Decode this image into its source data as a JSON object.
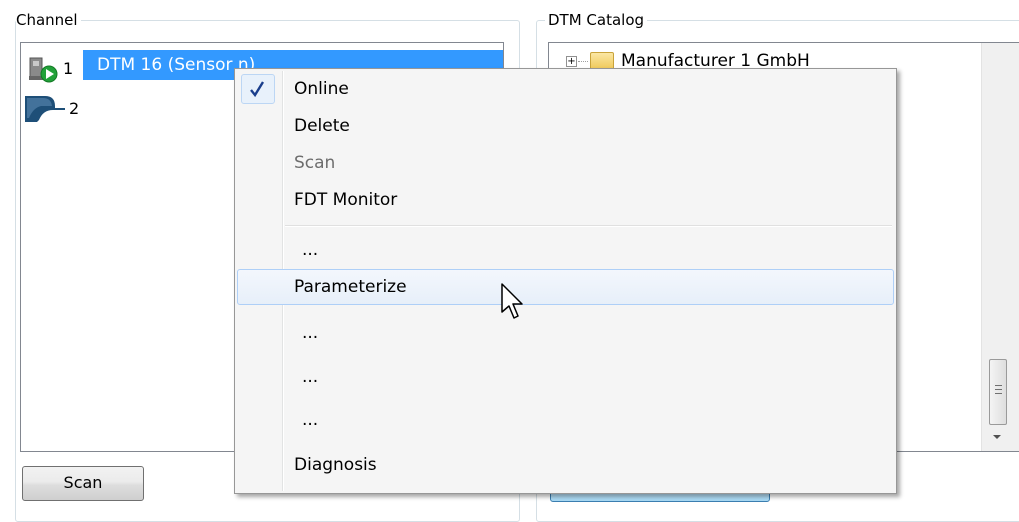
{
  "channel": {
    "title": "Channel",
    "items": [
      {
        "number": "1",
        "label": "DTM 16 (Sensor n)",
        "icon": "device-online-icon"
      },
      {
        "number": "2",
        "label": "",
        "icon": "channel-connector-icon"
      }
    ],
    "scan_button": "Scan"
  },
  "catalog": {
    "title": "DTM Catalog",
    "items": [
      {
        "label": "Manufacturer 1 GmbH",
        "icon": "folder-icon"
      }
    ]
  },
  "context_menu": {
    "items": [
      {
        "label": "Online",
        "checked": true,
        "enabled": true
      },
      {
        "label": "Delete",
        "enabled": true
      },
      {
        "label": "Scan",
        "enabled": false
      },
      {
        "label": "FDT Monitor",
        "enabled": true
      },
      {
        "separator": true
      },
      {
        "label": "...",
        "enabled": true
      },
      {
        "label": "Parameterize",
        "enabled": true,
        "hovered": true
      },
      {
        "label": "...",
        "enabled": true
      },
      {
        "label": "...",
        "enabled": true
      },
      {
        "label": "...",
        "enabled": true
      },
      {
        "label": "Diagnosis",
        "enabled": true
      }
    ]
  },
  "colors": {
    "selection": "#3399ff",
    "menu_background": "#f5f5f5",
    "menu_hover_border": "#aecff7"
  }
}
